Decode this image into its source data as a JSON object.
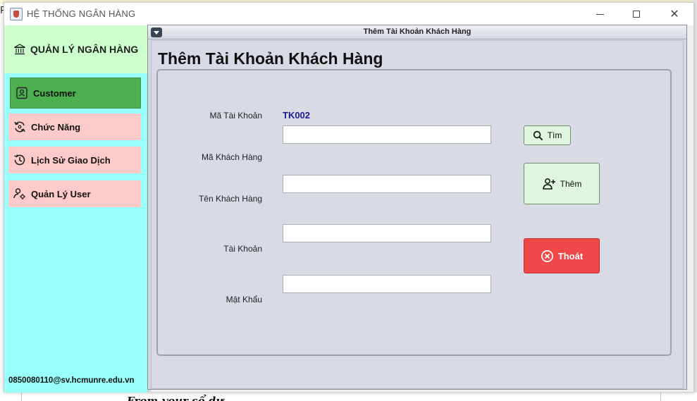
{
  "window": {
    "title": "HỆ THỐNG NGÂN HÀNG"
  },
  "sidebar": {
    "title": "QUẢN LÝ NGÂN HÀNG",
    "items": [
      {
        "label": "Customer",
        "icon": "id-card-icon",
        "active": true
      },
      {
        "label": "Chức Năng",
        "icon": "sync-icon",
        "active": false
      },
      {
        "label": "Lịch Sử Giao Dịch",
        "icon": "history-icon",
        "active": false
      },
      {
        "label": "Quản Lý User",
        "icon": "user-settings-icon",
        "active": false
      }
    ],
    "email": "0850080110@sv.hcmunre.edu.vn"
  },
  "frame": {
    "title": "Thêm Tài Khoản Khách Hàng",
    "heading": "Thêm Tài Khoản Khách Hàng"
  },
  "form": {
    "account_id_label": "Mã Tài Khoản",
    "account_id_value": "TK002",
    "customer_id_label": "Mã Khách Hàng",
    "customer_id_value": "",
    "customer_name_label": "Tên Khách Hàng",
    "customer_name_value": "",
    "account_label": "Tài Khoản",
    "account_value": "",
    "password_label": "Mật Khẩu",
    "password_value": ""
  },
  "buttons": {
    "search": "Tìm",
    "add": "Thêm",
    "exit": "Thoát"
  },
  "background": {
    "left_char": "P",
    "bottom_text": "From your sổ dư"
  },
  "colors": {
    "sidebar_bg": "#98fffb",
    "sidebar_header_bg": "#ccffcc",
    "nav_active": "#4caf50",
    "nav_item": "#fdcaca",
    "exit_button": "#f04848",
    "value_text": "#1a1a8c"
  }
}
